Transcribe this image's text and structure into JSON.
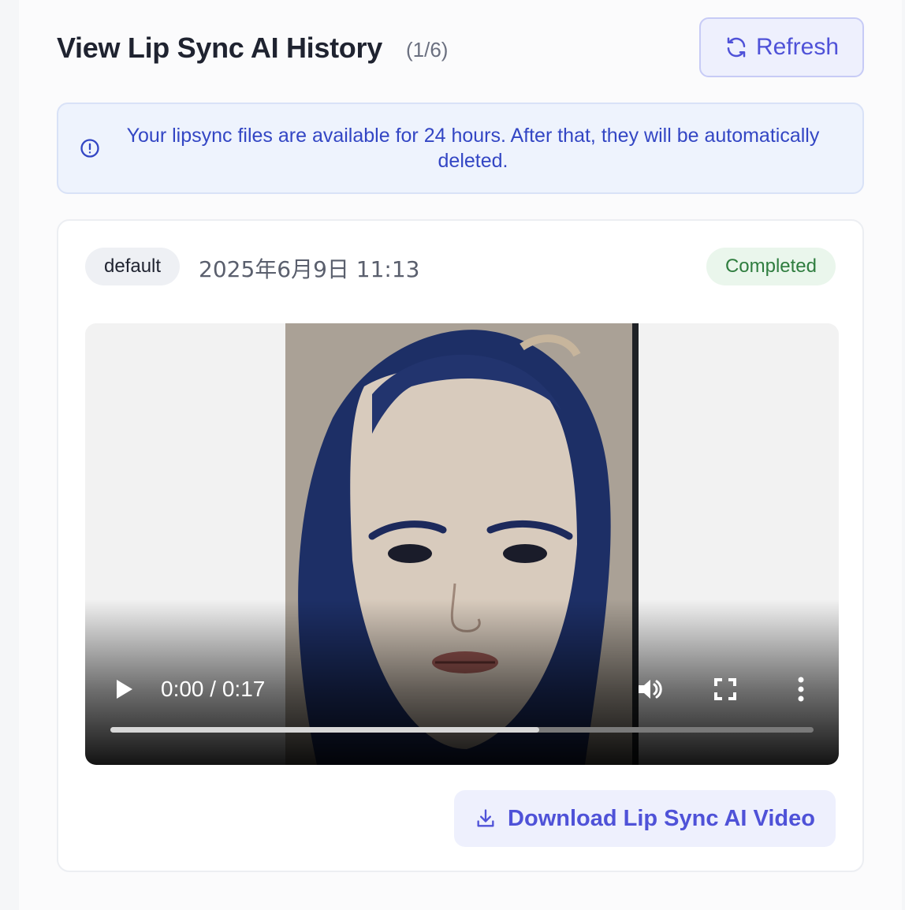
{
  "header": {
    "title": "View Lip Sync AI History",
    "count": "(1/6)",
    "refresh_label": "Refresh"
  },
  "notice": {
    "text": "Your lipsync files are available for 24 hours. After that, they will be automatically deleted."
  },
  "history_item": {
    "tag": "default",
    "date": "2025年6月9日 11:13",
    "status": "Completed",
    "player": {
      "current_time": "0:00",
      "separator": " / ",
      "duration": "0:17",
      "buffered_fraction": 0.61
    },
    "download_label": "Download Lip Sync AI Video"
  },
  "colors": {
    "accent": "#4f52d8",
    "notice_text": "#3346c4",
    "status_text": "#2f7d3f",
    "status_bg": "#eaf6ec"
  },
  "icons": [
    "refresh-icon",
    "info-icon",
    "play-icon",
    "volume-icon",
    "fullscreen-icon",
    "more-vertical-icon",
    "download-icon"
  ]
}
